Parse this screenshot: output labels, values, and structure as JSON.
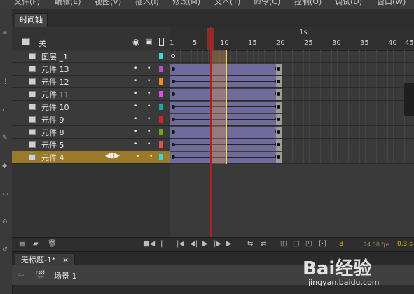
{
  "menu": [
    "文件(F)",
    "编辑(E)",
    "视图(V)",
    "插入(I)",
    "修改(M)",
    "文本(T)",
    "命令(C)",
    "控制(O)",
    "调试(D)",
    "窗口(W)"
  ],
  "panel_tab": "时间轴",
  "layer_header": {
    "label": "关",
    "eye_icon": "eye-icon",
    "lock_icon": "lock-icon"
  },
  "layers": [
    {
      "name": "图层 _1",
      "color": "#3ad6e0",
      "selected": false
    },
    {
      "name": "元件 13",
      "color": "#b44fd8",
      "selected": false
    },
    {
      "name": "元件 12",
      "color": "#f08a22",
      "selected": false
    },
    {
      "name": "元件 11",
      "color": "#e050e0",
      "selected": false
    },
    {
      "name": "元件 10",
      "color": "#1ea3a8",
      "selected": false
    },
    {
      "name": "元件 9",
      "color": "#d42424",
      "selected": false
    },
    {
      "name": "元件 8",
      "color": "#7ea020",
      "selected": false
    },
    {
      "name": "元件 5",
      "color": "#e05050",
      "selected": false
    },
    {
      "name": "元件 4",
      "color": "#3ad6e0",
      "selected": true
    }
  ],
  "ruler": {
    "seconds_label": "1s",
    "ticks": [
      "1",
      "5",
      "10",
      "15",
      "20",
      "25",
      "30",
      "35",
      "40",
      "45"
    ]
  },
  "current_frame": "8",
  "fps": "24.00 fps",
  "elapsed": "0.3 s",
  "doc_tab": "无标题-1*",
  "doc_close": "×",
  "scene_label": "场景 1",
  "watermark": {
    "logo": "Bai经验",
    "url": "jingyan.baidu.com"
  }
}
